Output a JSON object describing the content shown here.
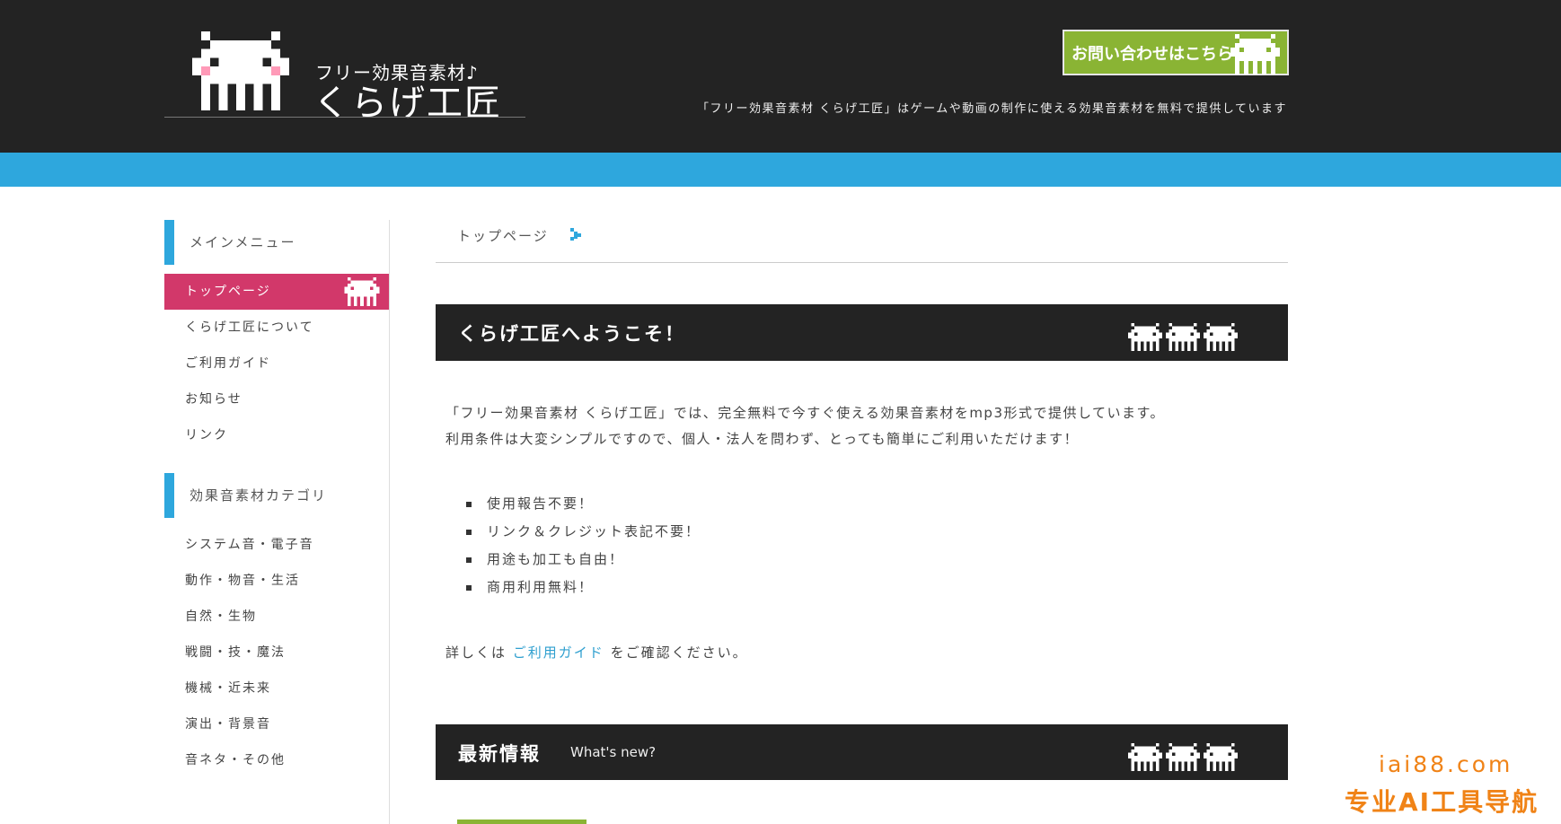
{
  "header": {
    "logo_subtitle": "フリー効果音素材♪",
    "logo_title": "くらげ工匠",
    "contact_button": "お問い合わせはこちら",
    "tagline": "「フリー効果音素材 くらげ工匠」はゲームや動画の制作に使える効果音素材を無料で提供しています"
  },
  "sidebar": {
    "main_menu_heading": "メインメニュー",
    "main_menu": [
      {
        "label": "トップページ",
        "active": true
      },
      {
        "label": "くらげ工匠について",
        "active": false
      },
      {
        "label": "ご利用ガイド",
        "active": false
      },
      {
        "label": "お知らせ",
        "active": false
      },
      {
        "label": "リンク",
        "active": false
      }
    ],
    "category_heading": "効果音素材カテゴリ",
    "categories": [
      {
        "label": "システム音・電子音"
      },
      {
        "label": "動作・物音・生活"
      },
      {
        "label": "自然・生物"
      },
      {
        "label": "戦闘・技・魔法"
      },
      {
        "label": "機械・近未来"
      },
      {
        "label": "演出・背景音"
      },
      {
        "label": "音ネタ・その他"
      }
    ]
  },
  "breadcrumb": {
    "current": "トップページ",
    "arrow_icon": "pixel-arrow-icon"
  },
  "welcome": {
    "title": "くらげ工匠へようこそ！",
    "intro_line1": "「フリー効果音素材 くらげ工匠」では、完全無料で今すぐ使える効果音素材をmp3形式で提供しています。",
    "intro_line2": "利用条件は大変シンプルですので、個人・法人を問わず、とっても簡単にご利用いただけます！",
    "features": [
      "使用報告不要！",
      "リンク＆クレジット表記不要！",
      "用途も加工も自由！",
      "商用利用無料！"
    ],
    "detail_prefix": "詳しくは",
    "detail_link": "ご利用ガイド",
    "detail_suffix": "をご確認ください。"
  },
  "news": {
    "title": "最新情報",
    "subtitle": "What's new?"
  },
  "watermark": {
    "domain": "iai88.com",
    "label": "专业AI工具导航"
  },
  "colors": {
    "header_bg": "#232323",
    "accent_blue": "#2ea7dd",
    "active_pink": "#d2386a",
    "contact_green": "#8ab434",
    "link_blue": "#2e9fcf",
    "watermark_orange": "#f08317"
  },
  "icons": {
    "mascot": "jellyfish-mascot-icon",
    "bullet": "square-bullet-icon"
  }
}
